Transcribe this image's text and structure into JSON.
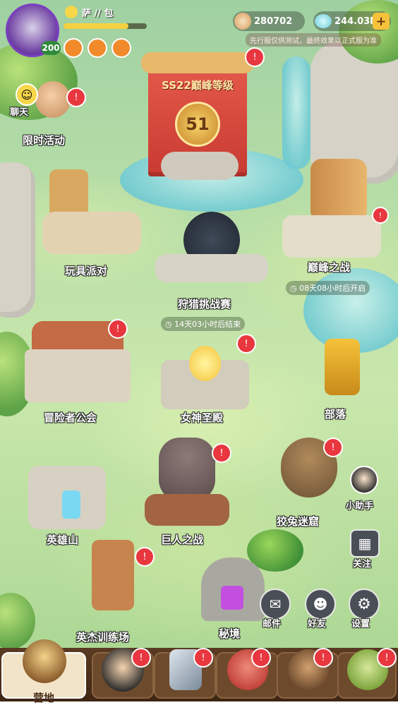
{
  "player": {
    "name": "萨 // 包",
    "level": "200"
  },
  "currency": {
    "gold": "280702",
    "gems": "244.03M",
    "notice": "先行服仅供测试，最终效果以正式服为准"
  },
  "chat": {
    "label": "聊天"
  },
  "left_event": {
    "label": "限时活动"
  },
  "banner": {
    "season_title": "SS22巅峰等级",
    "level": "51"
  },
  "buildings": {
    "toy_party": "玩具派对",
    "peak_battle": "巅峰之战",
    "peak_battle_timer": "08天08小时后开启",
    "hunt_challenge": "狩猎挑战赛",
    "hunt_timer": "14天03小时后结束",
    "adventurer_guild": "冒险者公会",
    "goddess_temple": "女神圣殿",
    "tribe": "部落",
    "hero_mountain": "英雄山",
    "giant_battle": "巨人之战",
    "rabbit_maze": "狡兔迷窟",
    "hero_training": "英杰训练场",
    "secret_realm": "秘境"
  },
  "side_buttons": {
    "helper": "小助手",
    "follow": "关注",
    "mail": "邮件",
    "friends": "好友",
    "settings": "设置"
  },
  "bottom_tabs": {
    "camp": "营地"
  },
  "colors": {
    "alert_red": "#e8373f",
    "bottom_bar": "#4a2e1a",
    "accent_gold": "#f5c23a"
  }
}
